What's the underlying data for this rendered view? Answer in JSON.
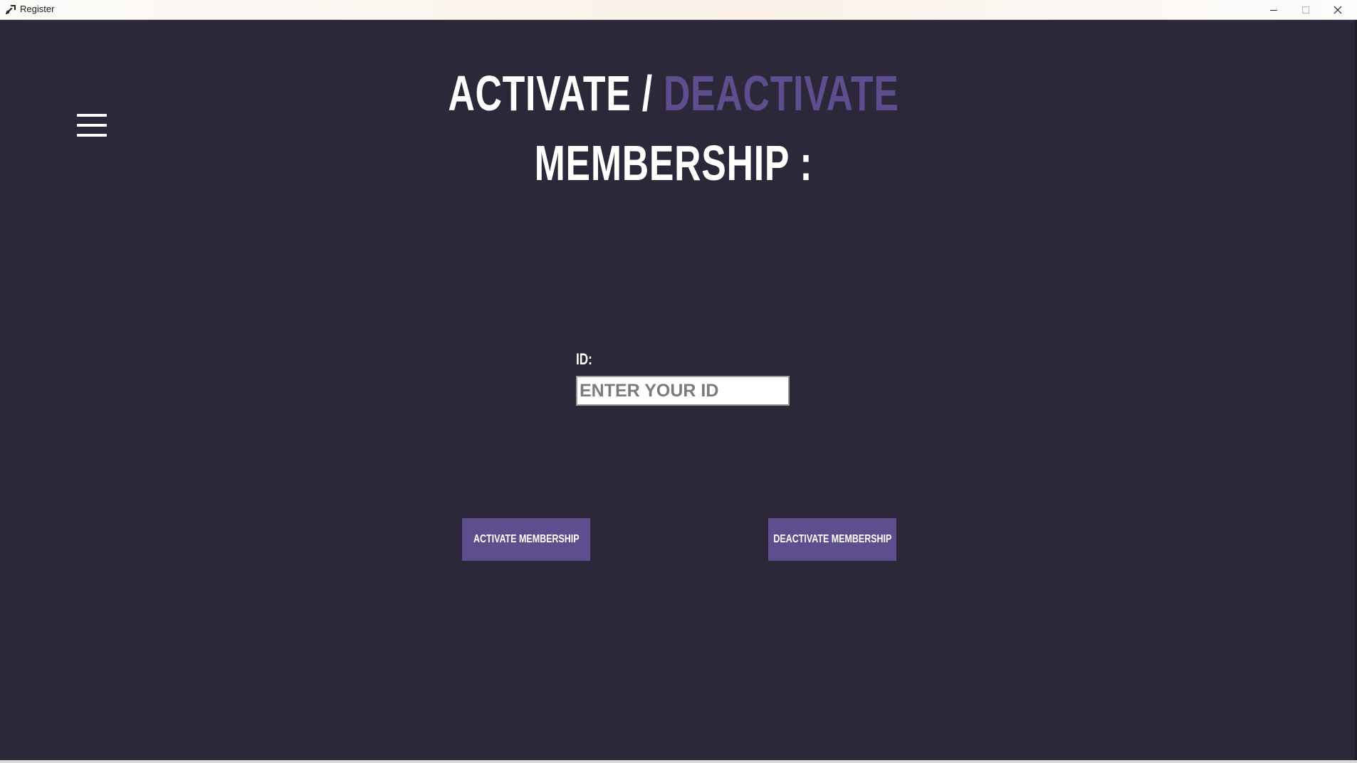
{
  "window": {
    "title": "Register",
    "controls": {
      "minimize_icon": "minimize-icon",
      "maximize_icon": "maximize-icon",
      "close_icon": "close-icon"
    }
  },
  "nav": {
    "menu_icon": "hamburger-menu-icon"
  },
  "heading": {
    "part1": "ACTIVATE / ",
    "part2_accent": "DEACTIVATE",
    "line2": "MEMBERSHIP :"
  },
  "form": {
    "id_label": "ID:",
    "id_value": "",
    "id_placeholder": "ENTER YOUR ID"
  },
  "buttons": {
    "activate_label": "ACTIVATE MEMBERSHIP",
    "deactivate_label": "DEACTIVATE MEMBERSHIP"
  },
  "colors": {
    "background": "#2c2739",
    "accent": "#5d4f8d",
    "text": "#ffffff"
  }
}
